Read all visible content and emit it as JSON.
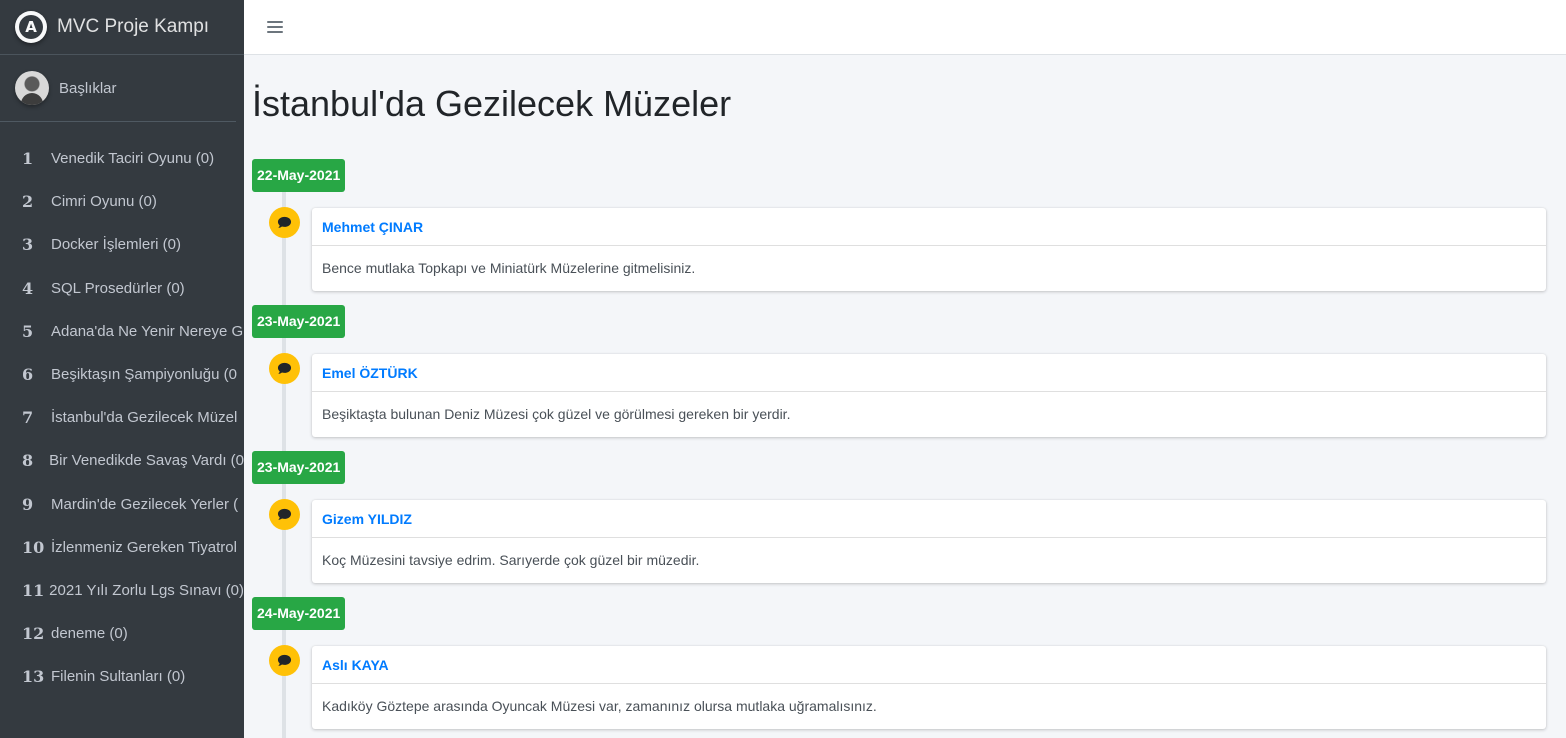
{
  "brand": {
    "name": "MVC Proje Kampı",
    "logo_letter": "A"
  },
  "user": {
    "name": "Başlıklar"
  },
  "sidebar": {
    "items": [
      {
        "num": "1",
        "label": "Venedik Taciri Oyunu (0)"
      },
      {
        "num": "2",
        "label": "Cimri Oyunu (0)"
      },
      {
        "num": "3",
        "label": "Docker İşlemleri (0)"
      },
      {
        "num": "4",
        "label": "SQL Prosedürler (0)"
      },
      {
        "num": "5",
        "label": "Adana'da Ne Yenir Nereye G"
      },
      {
        "num": "6",
        "label": "Beşiktaşın Şampiyonluğu (0"
      },
      {
        "num": "7",
        "label": "İstanbul'da Gezilecek Müzel"
      },
      {
        "num": "8",
        "label": "Bir Venedikde Savaş Vardı (0"
      },
      {
        "num": "9",
        "label": "Mardin'de Gezilecek Yerler ("
      },
      {
        "num": "10",
        "label": "İzlenmeniz Gereken Tiyatrol"
      },
      {
        "num": "11",
        "label": "2021 Yılı Zorlu Lgs Sınavı (0)"
      },
      {
        "num": "12",
        "label": "deneme (0)"
      },
      {
        "num": "13",
        "label": "Filenin Sultanları (0)"
      }
    ]
  },
  "page": {
    "title": "İstanbul'da Gezilecek Müzeler"
  },
  "entries": [
    {
      "date": "22-May-2021",
      "author": "Mehmet ÇINAR",
      "text": "Bence mutlaka Topkapı ve Miniatürk Müzelerine gitmelisiniz."
    },
    {
      "date": "23-May-2021",
      "author": "Emel ÖZTÜRK",
      "text": "Beşiktaşta bulunan Deniz Müzesi çok güzel ve görülmesi gereken bir yerdir."
    },
    {
      "date": "23-May-2021",
      "author": "Gizem YILDIZ",
      "text": "Koç Müzesini tavsiye edrim. Sarıyerde çok güzel bir müzedir."
    },
    {
      "date": "24-May-2021",
      "author": "Aslı KAYA",
      "text": "Kadıköy Göztepe arasında Oyuncak Müzesi var, zamanınız olursa mutlaka uğramalısınız."
    }
  ],
  "colors": {
    "sidebar_bg": "#343a40",
    "date_badge": "#28a745",
    "chat_icon": "#ffc107",
    "author_link": "#007bff"
  },
  "icons": {
    "brand": "brand-logo-icon",
    "menu": "hamburger-icon",
    "entry": "comment-icon"
  }
}
